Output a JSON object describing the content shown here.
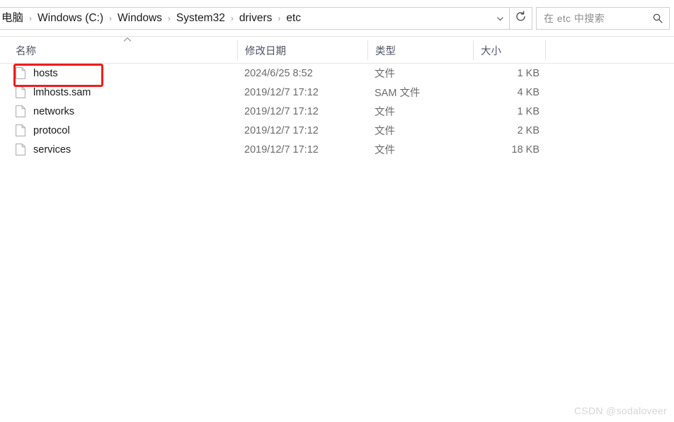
{
  "address_bar": {
    "breadcrumb": [
      "电脑",
      "Windows (C:)",
      "Windows",
      "System32",
      "drivers",
      "etc"
    ],
    "separator": "›",
    "dropdown_icon": "chevron-down-icon",
    "refresh_icon": "refresh-icon"
  },
  "search": {
    "placeholder": "在 etc 中搜索",
    "icon": "search-icon"
  },
  "columns": [
    {
      "label": "名称",
      "key": "name"
    },
    {
      "label": "修改日期",
      "key": "date"
    },
    {
      "label": "类型",
      "key": "type"
    },
    {
      "label": "大小",
      "key": "size"
    }
  ],
  "sort": {
    "column": "名称",
    "direction": "ascending",
    "indicator_icon": "chevron-up-icon"
  },
  "files": [
    {
      "name": "hosts",
      "date": "2024/6/25 8:52",
      "type": "文件",
      "size": "1 KB",
      "icon": "file-icon",
      "highlighted": true
    },
    {
      "name": "lmhosts.sam",
      "date": "2019/12/7 17:12",
      "type": "SAM 文件",
      "size": "4 KB",
      "icon": "file-icon",
      "highlighted": false
    },
    {
      "name": "networks",
      "date": "2019/12/7 17:12",
      "type": "文件",
      "size": "1 KB",
      "icon": "file-icon",
      "highlighted": false
    },
    {
      "name": "protocol",
      "date": "2019/12/7 17:12",
      "type": "文件",
      "size": "2 KB",
      "icon": "file-icon",
      "highlighted": false
    },
    {
      "name": "services",
      "date": "2019/12/7 17:12",
      "type": "文件",
      "size": "18 KB",
      "icon": "file-icon",
      "highlighted": false
    }
  ],
  "annotation": {
    "target": "hosts",
    "color": "#ee1d1d"
  },
  "watermark": {
    "text": "CSDN @sodaloveer"
  }
}
